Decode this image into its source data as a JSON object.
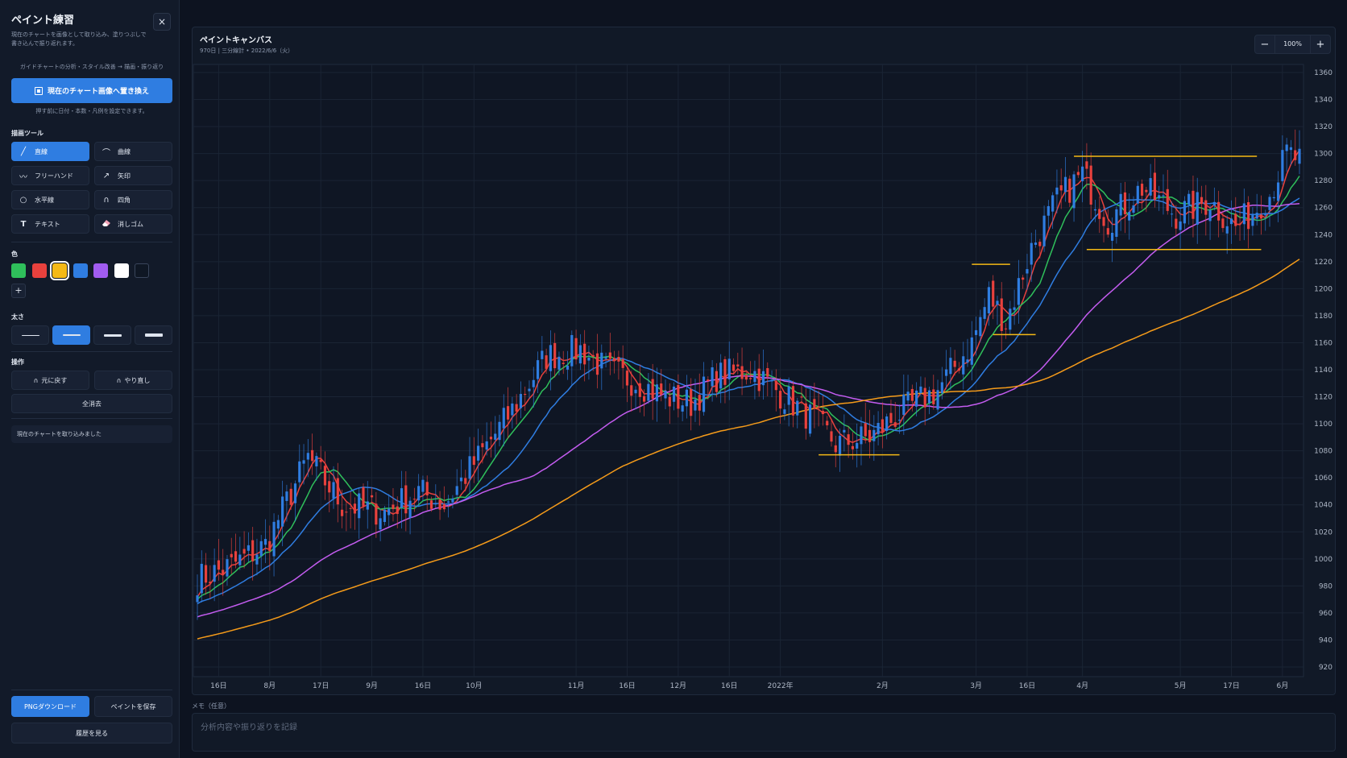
{
  "sidebar": {
    "title": "ペイント練習",
    "close_label": "×",
    "description": "現在のチャートを画像として取り込み、塗りつぶしで書き込んで振り返れます。",
    "guide": "ガイドチャートの分析・スタイル改善 → 描画・振り返り",
    "replace_button": "現在のチャート画像へ置き換え",
    "replace_note": "押す前に日付・本数・凡例を設定できます。",
    "tools_label": "描画ツール",
    "tools": [
      {
        "label": "直線",
        "icon": "line-icon"
      },
      {
        "label": "曲線",
        "icon": "curve-icon"
      },
      {
        "label": "フリーハンド",
        "icon": "freehand-icon"
      },
      {
        "label": "矢印",
        "icon": "arrow-icon"
      },
      {
        "label": "水平線",
        "icon": "circle-icon"
      },
      {
        "label": "四角",
        "icon": "rect-icon"
      },
      {
        "label": "テキスト",
        "icon": "text-icon"
      },
      {
        "label": "消しゴム",
        "icon": "eraser-icon"
      }
    ],
    "color_label": "色",
    "colors": [
      "#2fbf5b",
      "#e8413d",
      "#f5b915",
      "#2f7de1",
      "#a15cf0",
      "#ffffff",
      "#0f1724"
    ],
    "selected_color_index": 2,
    "add_color_label": "+",
    "width_label": "太さ",
    "widths": [
      1,
      2,
      3,
      4
    ],
    "selected_width_index": 1,
    "ops_label": "操作",
    "undo_label": "元に戻す",
    "redo_label": "やり直し",
    "clear_label": "全消去",
    "status": "現在のチャートを取り込みました",
    "download_label": "PNGダウンロード",
    "save_label": "ペイントを保存",
    "history_label": "履歴を見る"
  },
  "canvas": {
    "title": "ペイントキャンバス",
    "subtitle": "970日 | 三分線計 • 2022/6/6（火）",
    "zoom_out": "−",
    "zoom_in": "+",
    "zoom": "100%"
  },
  "memo": {
    "label": "メモ（任意）",
    "placeholder": "分析内容や振り返りを記録"
  },
  "chart_data": {
    "type": "candlestick",
    "y_range": [
      920,
      1360
    ],
    "y_ticks": [
      920,
      940,
      960,
      980,
      1000,
      1020,
      1040,
      1060,
      1080,
      1100,
      1120,
      1140,
      1160,
      1180,
      1200,
      1220,
      1240,
      1260,
      1280,
      1300,
      1320,
      1340,
      1360
    ],
    "x_labels": [
      {
        "label": "16日",
        "i": 5
      },
      {
        "label": "8月",
        "i": 17
      },
      {
        "label": "17日",
        "i": 29
      },
      {
        "label": "9月",
        "i": 41
      },
      {
        "label": "16日",
        "i": 53
      },
      {
        "label": "10月",
        "i": 65
      },
      {
        "label": "11月",
        "i": 89
      },
      {
        "label": "16日",
        "i": 101
      },
      {
        "label": "12月",
        "i": 113
      },
      {
        "label": "16日",
        "i": 125
      },
      {
        "label": "2022年",
        "i": 137
      },
      {
        "label": "2月",
        "i": 161
      },
      {
        "label": "3月",
        "i": 183
      },
      {
        "label": "16日",
        "i": 195
      },
      {
        "label": "4月",
        "i": 208
      },
      {
        "label": "5月",
        "i": 231
      },
      {
        "label": "17日",
        "i": 243
      },
      {
        "label": "6月",
        "i": 255
      }
    ],
    "bars": 260,
    "close_anchors": [
      [
        0,
        985
      ],
      [
        8,
        995
      ],
      [
        16,
        1010
      ],
      [
        26,
        1075
      ],
      [
        34,
        1040
      ],
      [
        44,
        1035
      ],
      [
        52,
        1050
      ],
      [
        58,
        1040
      ],
      [
        66,
        1075
      ],
      [
        74,
        1110
      ],
      [
        82,
        1150
      ],
      [
        90,
        1155
      ],
      [
        96,
        1140
      ],
      [
        104,
        1130
      ],
      [
        110,
        1120
      ],
      [
        116,
        1115
      ],
      [
        122,
        1135
      ],
      [
        130,
        1140
      ],
      [
        136,
        1125
      ],
      [
        146,
        1100
      ],
      [
        150,
        1085
      ],
      [
        158,
        1090
      ],
      [
        166,
        1110
      ],
      [
        174,
        1125
      ],
      [
        182,
        1160
      ],
      [
        186,
        1195
      ],
      [
        190,
        1175
      ],
      [
        196,
        1230
      ],
      [
        202,
        1265
      ],
      [
        208,
        1285
      ],
      [
        214,
        1250
      ],
      [
        222,
        1275
      ],
      [
        230,
        1255
      ],
      [
        238,
        1265
      ],
      [
        244,
        1245
      ],
      [
        252,
        1270
      ],
      [
        256,
        1300
      ],
      [
        259,
        1295
      ]
    ],
    "ma_series": [
      {
        "name": "MA5",
        "color": "#e8413d",
        "period": 5
      },
      {
        "name": "MA10",
        "color": "#2fbf5b",
        "period": 10
      },
      {
        "name": "MA20",
        "color": "#2f7de1",
        "period": 20
      },
      {
        "name": "MA50",
        "color": "#c45cf0",
        "period": 50
      },
      {
        "name": "MA100",
        "color": "#f59b1a",
        "period": 100
      }
    ],
    "annotations": [
      {
        "type": "hline",
        "from": 146,
        "to": 165,
        "y": 1077
      },
      {
        "type": "hline",
        "from": 182,
        "to": 191,
        "y": 1218
      },
      {
        "type": "hline",
        "from": 187,
        "to": 197,
        "y": 1166
      },
      {
        "type": "hline",
        "from": 206,
        "to": 249,
        "y": 1298
      },
      {
        "type": "hline",
        "from": 209,
        "to": 250,
        "y": 1229
      }
    ],
    "up_color": "#2f7de1",
    "down_color": "#e8413d",
    "annotation_color": "#f5b915"
  }
}
